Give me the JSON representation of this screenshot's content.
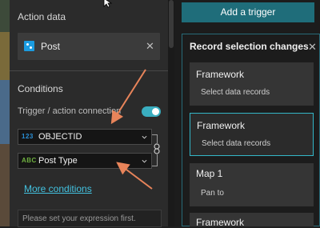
{
  "left_panel": {
    "action_data_title": "Action data",
    "action_item": {
      "label": "Post"
    },
    "conditions_title": "Conditions",
    "connection_label": "Trigger / action connection",
    "connection_enabled": true,
    "field_1": {
      "type_badge": "123",
      "name": "OBJECTID"
    },
    "field_2": {
      "type_badge": "ABC",
      "name": "Post Type"
    },
    "more_conditions_link": "More conditions",
    "expression_placeholder": "Please set your expression first."
  },
  "right_panel": {
    "add_trigger_button": "Add a trigger",
    "panel_title": "Record selection changes",
    "cards": [
      {
        "title": "Framework",
        "subtitle": "Select data records",
        "selected": false
      },
      {
        "title": "Framework",
        "subtitle": "Select data records",
        "selected": true
      },
      {
        "title": "Map 1",
        "subtitle": "Pan to",
        "selected": false
      },
      {
        "title": "Framework",
        "subtitle": "",
        "selected": false
      }
    ]
  },
  "colors": {
    "accent": "#3aaec0",
    "annotation_arrow": "#e8845a",
    "link": "#43c2e0"
  }
}
